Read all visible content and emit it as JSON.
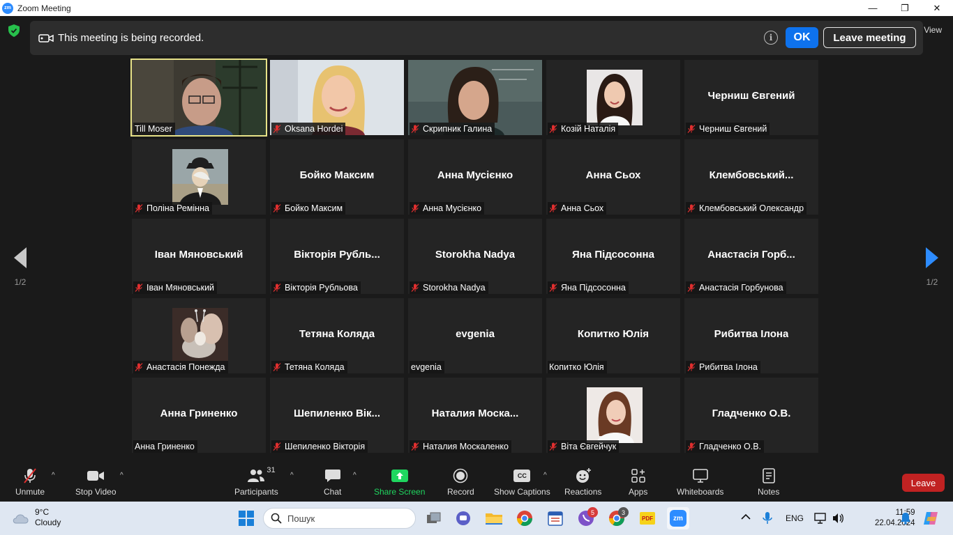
{
  "window": {
    "title": "Zoom Meeting",
    "app_icon_text": "zm",
    "minimize": "—",
    "maximize": "❐",
    "close": "✕"
  },
  "banner": {
    "text": "This meeting is being recorded.",
    "ok_label": "OK",
    "leave_label": "Leave meeting",
    "view_label": "View"
  },
  "pager": {
    "left": "1/2",
    "right": "1/2"
  },
  "participants": [
    {
      "label": "Till Moser",
      "muted": false,
      "video": "photo",
      "active": true
    },
    {
      "label": "Oksana Hordei",
      "muted": true,
      "video": "photo"
    },
    {
      "label": "Скрипник Галина",
      "muted": true,
      "video": "photo"
    },
    {
      "label": "Козій Наталія",
      "muted": true,
      "video": "avatar"
    },
    {
      "label": "Черниш Євгений",
      "center": "Черниш Євгений",
      "muted": true
    },
    {
      "label": "Поліна Ремінна",
      "muted": true,
      "video": "avatar"
    },
    {
      "label": "Бойко Максим",
      "center": "Бойко Максим",
      "muted": true
    },
    {
      "label": "Анна Мусієнко",
      "center": "Анна Мусієнко",
      "muted": true
    },
    {
      "label": "Анна Сьох",
      "center": "Анна Сьох",
      "muted": true
    },
    {
      "label": "Клембовський Олександр",
      "center": "Клембовський...",
      "muted": true
    },
    {
      "label": "Іван Мяновський",
      "center": "Іван Мяновський",
      "muted": true
    },
    {
      "label": "Вікторія Рубльова",
      "center": "Вікторія  Рубль...",
      "muted": true
    },
    {
      "label": "Storokha Nadya",
      "center": "Storokha Nadya",
      "muted": true
    },
    {
      "label": "Яна Підсосонна",
      "center": "Яна Підсосонна",
      "muted": true
    },
    {
      "label": "Анастасія Горбунова",
      "center": "Анастасія  Горб...",
      "muted": true
    },
    {
      "label": "Анастасія Понежда",
      "muted": true,
      "video": "avatar"
    },
    {
      "label": "Тетяна Коляда",
      "center": "Тетяна Коляда",
      "muted": true
    },
    {
      "label": "evgenia",
      "center": "evgenia",
      "muted": false
    },
    {
      "label": "Копитко Юлія",
      "center": "Копитко Юлія",
      "muted": false
    },
    {
      "label": "Рибитва Ілона",
      "center": "Рибитва Ілона",
      "muted": true
    },
    {
      "label": "Анна Гриненко",
      "center": "Анна Гриненко",
      "muted": false
    },
    {
      "label": "Шепиленко Вікторія",
      "center": "Шепиленко  Вік...",
      "muted": true
    },
    {
      "label": "Наталия Москаленко",
      "center": "Наталия  Моска...",
      "muted": true
    },
    {
      "label": "Віта Євгейчук",
      "muted": true,
      "video": "avatar"
    },
    {
      "label": "Гладченко О.В.",
      "center": "Гладченко О.В.",
      "muted": true
    }
  ],
  "toolbar": {
    "unmute": "Unmute",
    "stop_video": "Stop Video",
    "participants": "Participants",
    "participants_count": "31",
    "chat": "Chat",
    "share_screen": "Share Screen",
    "record": "Record",
    "show_captions": "Show Captions",
    "captions_icon_text": "CC",
    "reactions": "Reactions",
    "apps": "Apps",
    "whiteboards": "Whiteboards",
    "notes": "Notes",
    "leave": "Leave"
  },
  "taskbar": {
    "temperature": "9°C",
    "weather": "Cloudy",
    "search_placeholder": "Пошук",
    "viber_badge": "5",
    "chrome_badge": "3",
    "pdf_label": "PDF",
    "zoom_label": "zm",
    "language": "ENG",
    "time": "11:59",
    "date": "22.04.2024"
  },
  "colors": {
    "accent": "#0e72ed",
    "share_green": "#1fd65f",
    "leave_red": "#c12222",
    "active_speaker": "#e7e288"
  }
}
